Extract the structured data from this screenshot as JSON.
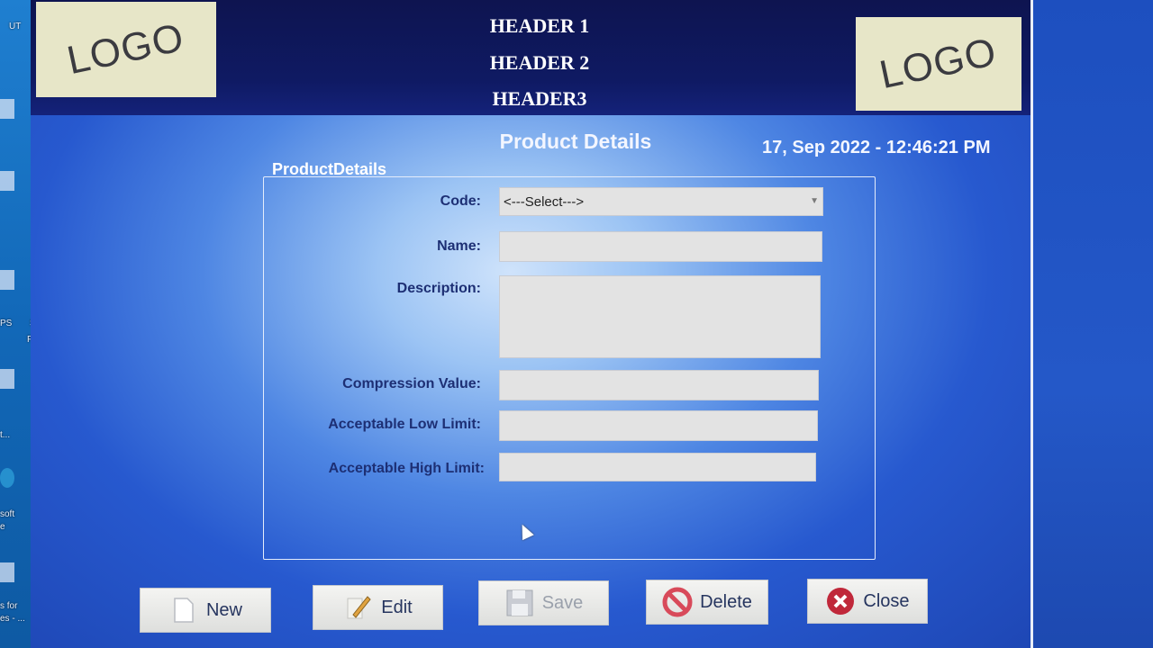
{
  "desktop": {
    "icons": [
      {
        "label": "UT"
      },
      {
        "label": "PS"
      },
      {
        "label": "S"
      },
      {
        "label": "PP"
      },
      {
        "label": "t..."
      },
      {
        "label": "soft"
      },
      {
        "label": "e"
      },
      {
        "label": "s for"
      },
      {
        "label": "es - ..."
      }
    ]
  },
  "header": {
    "logo_left": "LOGO",
    "logo_right": "LOGO",
    "line1": "HEADER 1",
    "line2": "HEADER 2",
    "line3": "HEADER3"
  },
  "page": {
    "title": "Product Details",
    "datetime": "17, Sep 2022  - 12:46:21 PM"
  },
  "form": {
    "legend": "ProductDetails",
    "code_label": "Code:",
    "code_value": "<---Select--->",
    "name_label": "Name:",
    "name_value": "",
    "description_label": "Description:",
    "description_value": "",
    "compression_label": "Compression Value:",
    "compression_value": "",
    "low_limit_label": "Acceptable Low Limit:",
    "low_limit_value": "",
    "high_limit_label": "Acceptable High Limit:",
    "high_limit_value": ""
  },
  "toolbar": {
    "new_label": "New",
    "edit_label": "Edit",
    "save_label": "Save",
    "delete_label": "Delete",
    "close_label": "Close"
  },
  "colors": {
    "header_band": "#0e1450",
    "label_text": "#1d2f74",
    "close_icon": "#c0283a",
    "delete_icon": "#d84a5a"
  }
}
